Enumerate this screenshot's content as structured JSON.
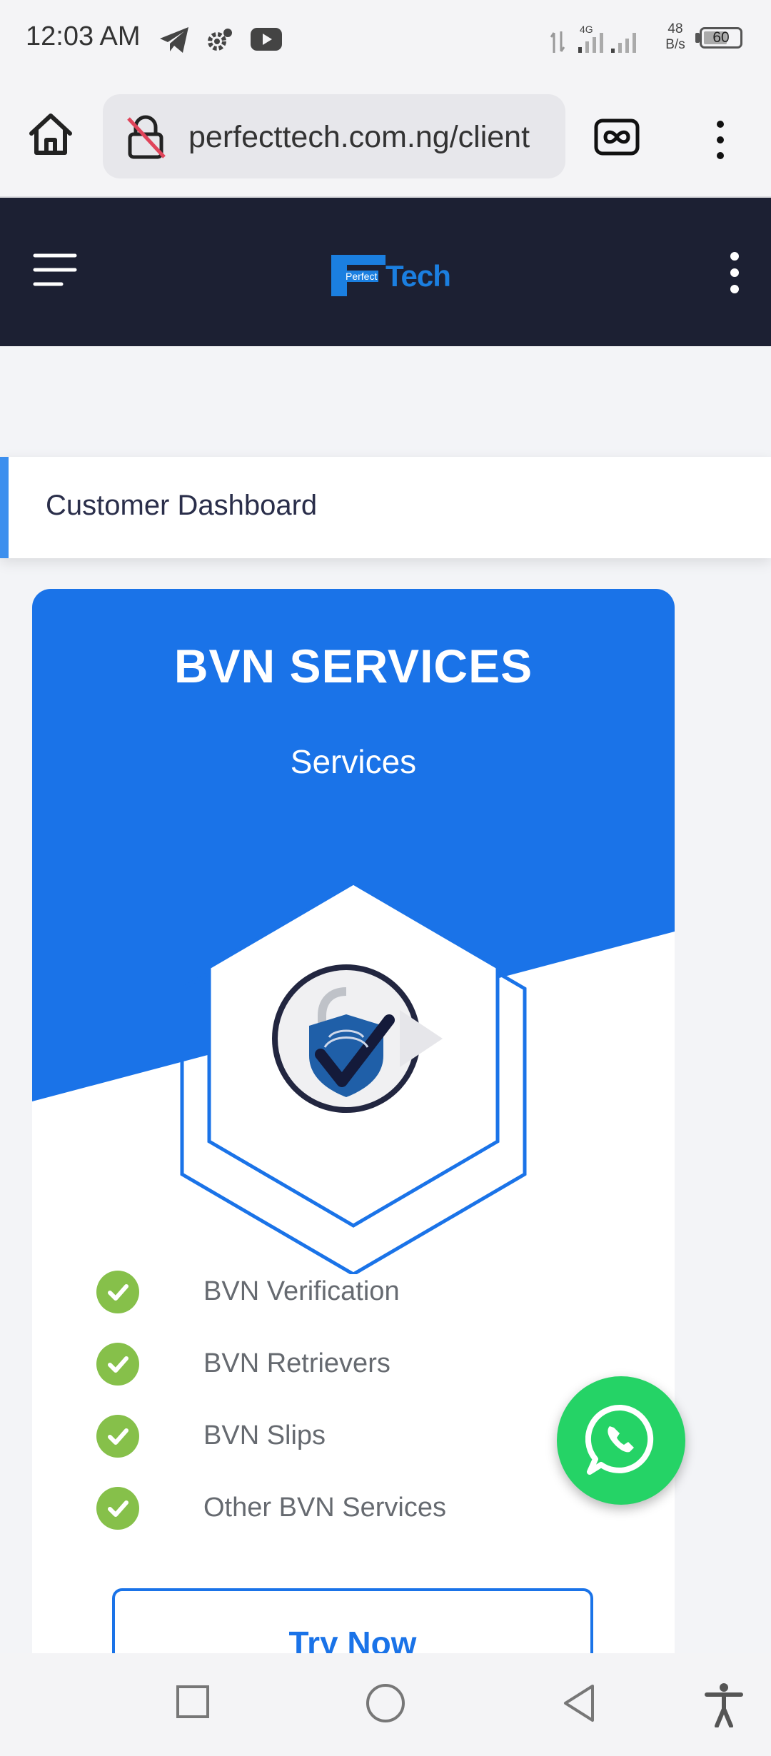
{
  "status_bar": {
    "time": "12:03 AM",
    "network": "4G",
    "net_speed_value": "48",
    "net_speed_unit": "B/s",
    "battery": "60"
  },
  "browser": {
    "url": "perfecttech.com.ng/client",
    "icons": [
      "home-icon",
      "not-secure-lock-icon",
      "tabs-icon",
      "overflow-menu-icon"
    ]
  },
  "site_header": {
    "logo_small": "Perfect",
    "logo_text": "Tech",
    "icons": [
      "hamburger-menu-icon",
      "more-options-icon"
    ]
  },
  "breadcrumb": {
    "title": "Customer Dashboard"
  },
  "card": {
    "title": "BVN SERVICES",
    "subtitle": "Services",
    "features": [
      "BVN Verification",
      "BVN Retrievers",
      "BVN Slips",
      "Other BVN Services"
    ],
    "button_label": "Try Now"
  },
  "colors": {
    "header_bg": "#1c2033",
    "card_blue": "#1a73e8",
    "check_green": "#86c04a",
    "whatsapp_green": "#25d366"
  }
}
